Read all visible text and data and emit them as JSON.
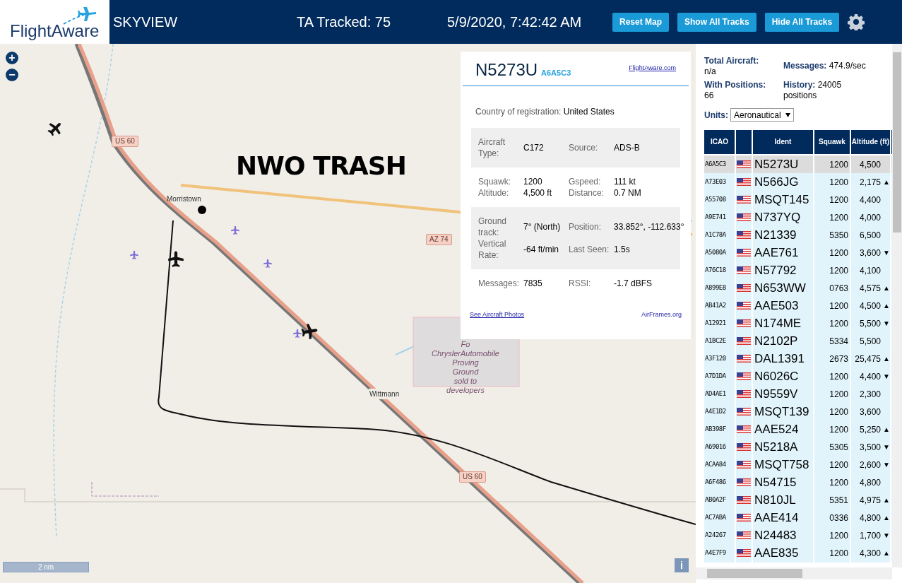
{
  "header": {
    "logo": "FlightAware",
    "app_name": "SKYVIEW",
    "tracked": "TA Tracked: 75",
    "datetime": "5/9/2020, 7:42:42 AM",
    "buttons": [
      "Reset Map",
      "Show All Tracks",
      "Hide All Tracks"
    ]
  },
  "map": {
    "zoom_in": "+",
    "zoom_out": "−",
    "overlay_text": "NWO TRASH",
    "labels": [
      {
        "kind": "shield",
        "text": "US 60"
      },
      {
        "kind": "shield",
        "text": "AZ 74"
      },
      {
        "kind": "shield",
        "text": "US 60"
      },
      {
        "kind": "town",
        "text": "Morristown"
      },
      {
        "kind": "town",
        "text": "Wittmann"
      },
      {
        "kind": "area",
        "text": "Fo\nChryslerAutomobile\nProving\nGround\nsold to\ndevelopers"
      }
    ],
    "scale": "2 nm",
    "info": "i"
  },
  "popup": {
    "registration": "N5273U",
    "icao": "A6A5C3",
    "link": "FlightAware.com",
    "country_label": "Country of registration:",
    "country": "United States",
    "groups": [
      {
        "shaded": true,
        "fields": [
          {
            "label": "Aircraft Type:",
            "value": "C172"
          },
          {
            "label": "Source:",
            "value": "ADS-B"
          }
        ]
      },
      {
        "shaded": false,
        "fields": [
          {
            "label": "Squawk:\nAltitude:",
            "value": "1200\n4,500 ft"
          },
          {
            "label": "Gspeed:\nDistance:",
            "value": "111 kt\n0.7 NM"
          }
        ]
      },
      {
        "shaded": true,
        "fields": [
          {
            "label": "Ground track:",
            "value": "7° (North)"
          },
          {
            "label": "Position:",
            "value": "33.852°, -112.633°"
          },
          {
            "label": "Vertical Rate:",
            "value": "-64 ft/min"
          },
          {
            "label": "Last Seen:",
            "value": "1.5s"
          }
        ]
      },
      {
        "shaded": false,
        "fields": [
          {
            "label": "Messages:",
            "value": "7835"
          },
          {
            "label": "RSSI:",
            "value": "-1.7 dBFS"
          }
        ]
      }
    ],
    "photos_link": "See Aircraft Photos",
    "airframes_link": "AirFrames.org"
  },
  "stats": {
    "total_label": "Total Aircraft:",
    "total": "n/a",
    "messages_label": "Messages:",
    "messages": "474.9/sec",
    "positions_label": "With Positions:",
    "positions": "66",
    "history_label": "History:",
    "history": "24005 positions",
    "units_label": "Units:",
    "units": "Aeronautical"
  },
  "table": {
    "columns": [
      "ICAO",
      "Ident",
      "Squawk",
      "Altitude (ft)"
    ],
    "rows": [
      {
        "icao": "A6A5C3",
        "ident": "N5273U",
        "squawk": "1200",
        "altitude": "4,500",
        "trend": "",
        "selected": true
      },
      {
        "icao": "A73E03",
        "ident": "N566JG",
        "squawk": "1200",
        "altitude": "2,175",
        "trend": "▲",
        "selected": false
      },
      {
        "icao": "A55708",
        "ident": "MSQT145",
        "squawk": "1200",
        "altitude": "4,400",
        "trend": "",
        "selected": false
      },
      {
        "icao": "A9E741",
        "ident": "N737YQ",
        "squawk": "1200",
        "altitude": "4,000",
        "trend": "",
        "selected": false
      },
      {
        "icao": "A1C78A",
        "ident": "N21339",
        "squawk": "5350",
        "altitude": "6,500",
        "trend": "",
        "selected": false
      },
      {
        "icao": "A5080A",
        "ident": "AAE761",
        "squawk": "1200",
        "altitude": "3,600",
        "trend": "▼",
        "selected": false
      },
      {
        "icao": "A76C18",
        "ident": "N57792",
        "squawk": "1200",
        "altitude": "4,100",
        "trend": "",
        "selected": false
      },
      {
        "icao": "A899E8",
        "ident": "N653WW",
        "squawk": "0763",
        "altitude": "4,575",
        "trend": "▲",
        "selected": false
      },
      {
        "icao": "AB41A2",
        "ident": "AAE503",
        "squawk": "1200",
        "altitude": "4,500",
        "trend": "▲",
        "selected": false
      },
      {
        "icao": "A12921",
        "ident": "N174ME",
        "squawk": "1200",
        "altitude": "5,500",
        "trend": "▼",
        "selected": false
      },
      {
        "icao": "A1BC2E",
        "ident": "N2102P",
        "squawk": "5334",
        "altitude": "5,500",
        "trend": "",
        "selected": false
      },
      {
        "icao": "A3F120",
        "ident": "DAL1391",
        "squawk": "2673",
        "altitude": "25,475",
        "trend": "▲",
        "selected": false
      },
      {
        "icao": "A7D1DA",
        "ident": "N6026C",
        "squawk": "1200",
        "altitude": "4,400",
        "trend": "▼",
        "selected": false
      },
      {
        "icao": "AD4AE1",
        "ident": "N9559V",
        "squawk": "1200",
        "altitude": "2,300",
        "trend": "",
        "selected": false
      },
      {
        "icao": "A4E1D2",
        "ident": "MSQT139",
        "squawk": "1200",
        "altitude": "3,600",
        "trend": "",
        "selected": false
      },
      {
        "icao": "AB398F",
        "ident": "AAE524",
        "squawk": "1200",
        "altitude": "5,250",
        "trend": "▲",
        "selected": false
      },
      {
        "icao": "A69016",
        "ident": "N5218A",
        "squawk": "5305",
        "altitude": "3,500",
        "trend": "▼",
        "selected": false
      },
      {
        "icao": "ACAA84",
        "ident": "MSQT758",
        "squawk": "1200",
        "altitude": "2,600",
        "trend": "▼",
        "selected": false
      },
      {
        "icao": "A6F486",
        "ident": "N54715",
        "squawk": "1200",
        "altitude": "4,800",
        "trend": "",
        "selected": false
      },
      {
        "icao": "AB0A2F",
        "ident": "N810JL",
        "squawk": "5351",
        "altitude": "4,975",
        "trend": "▲",
        "selected": false
      },
      {
        "icao": "AC7ABA",
        "ident": "AAE414",
        "squawk": "0336",
        "altitude": "4,800",
        "trend": "▲",
        "selected": false
      },
      {
        "icao": "A24267",
        "ident": "N24483",
        "squawk": "1200",
        "altitude": "1,700",
        "trend": "▼",
        "selected": false
      },
      {
        "icao": "A4E7F9",
        "ident": "AAE835",
        "squawk": "1200",
        "altitude": "4,300",
        "trend": "▲",
        "selected": false
      }
    ]
  }
}
